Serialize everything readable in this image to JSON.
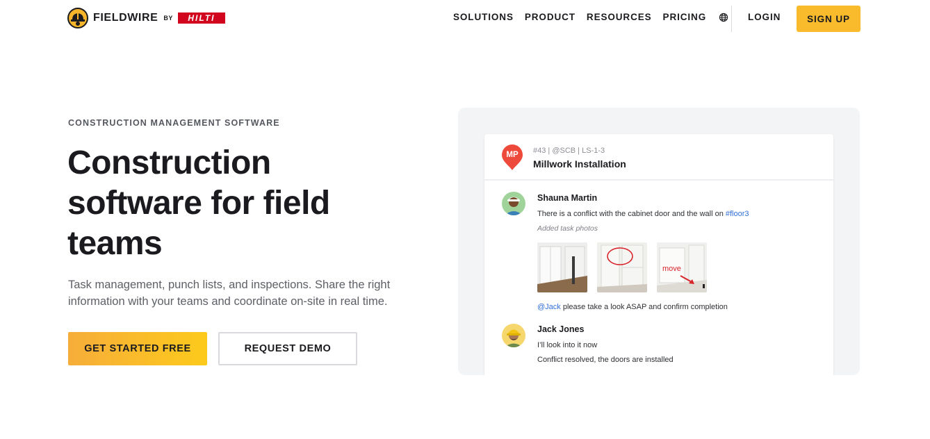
{
  "nav": {
    "logo_text": "FIELDWIRE",
    "logo_by": "BY",
    "partner_logo": "HILTI",
    "links": [
      {
        "label": "SOLUTIONS"
      },
      {
        "label": "PRODUCT"
      },
      {
        "label": "RESOURCES"
      },
      {
        "label": "PRICING"
      }
    ],
    "language_icon": "globe-icon",
    "login_label": "LOGIN",
    "signup_label": "SIGN UP"
  },
  "hero": {
    "eyebrow": "CONSTRUCTION MANAGEMENT SOFTWARE",
    "headline_line1": "Construction",
    "headline_line2": "software for field",
    "headline_line3": "teams",
    "subtext": "Task management, punch lists, and inspections. Share the right information with your teams and coordinate on-site in real time.",
    "cta_primary": "GET STARTED FREE",
    "cta_secondary": "REQUEST DEMO"
  },
  "task_card": {
    "pin_initials": "MP",
    "meta": "#43 | @SCB | LS-1-3",
    "title": "Millwork Installation",
    "comments": [
      {
        "author": "Shauna Martin",
        "text_before": "There is a conflict with the cabinet door and the wall on ",
        "text_link": "#floor3",
        "note": "Added task photos",
        "mention": "@Jack",
        "mention_rest": " please take a look ASAP and confirm completion"
      },
      {
        "author": "Jack Jones",
        "line1": "I’ll look into it now",
        "line2": "Conflict resolved, the doors are installed"
      }
    ],
    "photo_annotation": "move"
  },
  "colors": {
    "accent": "#f9bb2c",
    "brand_red": "#d2051e",
    "pin_red": "#ee4a3b",
    "link_blue": "#2f6fd8",
    "panel_bg": "#f3f4f6"
  }
}
